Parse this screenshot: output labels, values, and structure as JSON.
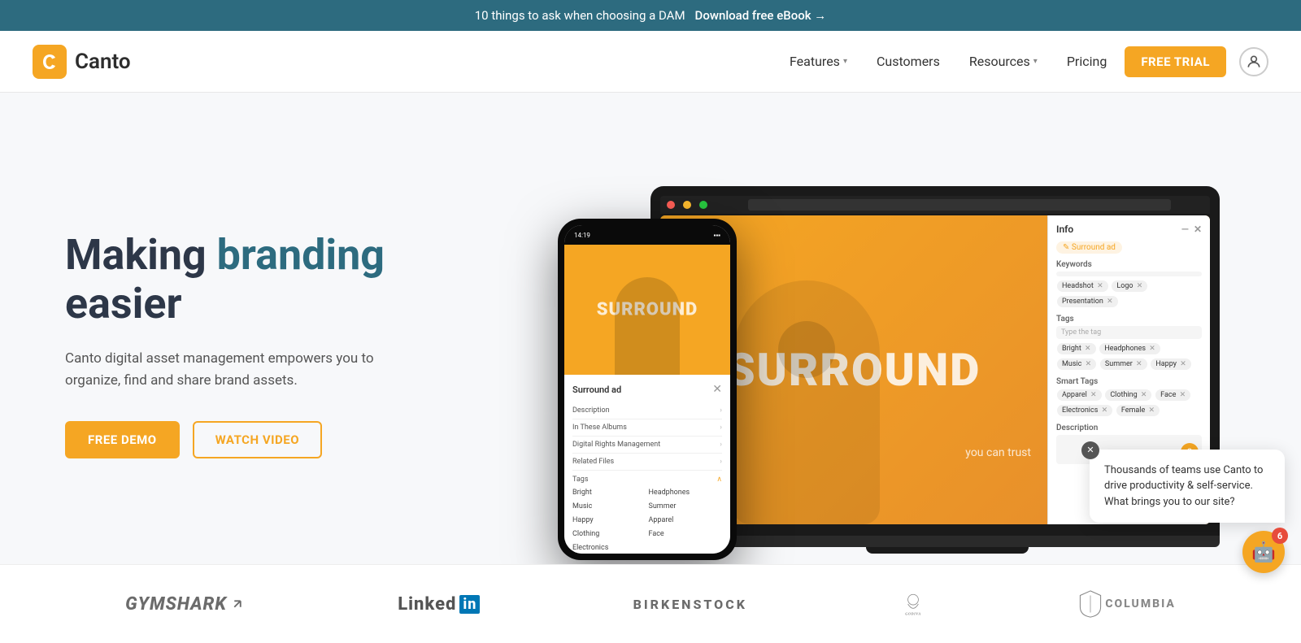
{
  "banner": {
    "text": "10 things to ask when choosing a DAM",
    "link_text": "Download free eBook →"
  },
  "header": {
    "logo_text": "Canto",
    "nav": {
      "features_label": "Features",
      "customers_label": "Customers",
      "resources_label": "Resources",
      "pricing_label": "Pricing",
      "free_trial_label": "FREE TRIAL"
    }
  },
  "hero": {
    "title_prefix": "Making ",
    "title_accent": "branding",
    "title_suffix": " easier",
    "description": "Canto digital asset management empowers you to organize, find and share brand assets.",
    "btn_demo": "FREE DEMO",
    "btn_video": "WATCH VIDEO"
  },
  "laptop_screen": {
    "overlay_text": "RROUND",
    "trust_text": "you can trust",
    "info_panel": {
      "header": "Info",
      "asset_name": "Surround ad",
      "keywords_label": "Keywords",
      "keyword_chips": [
        "Headshot",
        "Logo",
        "Presentation"
      ],
      "tags_label": "Tags",
      "tag_placeholder": "Type the tag",
      "tags": [
        "Bright",
        "Headphones",
        "Music",
        "Summer",
        "Happy"
      ],
      "smart_tags_label": "Smart Tags",
      "smart_tags": [
        "Apparel",
        "Clothing",
        "Face",
        "Electronics",
        "Female"
      ],
      "description_label": "Description"
    }
  },
  "phone_screen": {
    "time": "14:19",
    "asset_title": "Surround ad",
    "rows": [
      "Description",
      "In These Albums",
      "Digital Rights Management",
      "Related Files",
      "Tags"
    ],
    "tags": [
      "Bright",
      "Headphones",
      "Music",
      "Summer",
      "Happy",
      "Clothing",
      "Apparel",
      "Face",
      "Electronics"
    ]
  },
  "chat": {
    "message": "Thousands of teams use Canto to drive productivity & self-service. What brings you to our site?",
    "badge_count": "6"
  },
  "logos": {
    "brands": [
      "GYMSHARK",
      "LinkedIn",
      "BIRKENSTOCK",
      "GODIVA",
      "COLUMBIA"
    ]
  }
}
